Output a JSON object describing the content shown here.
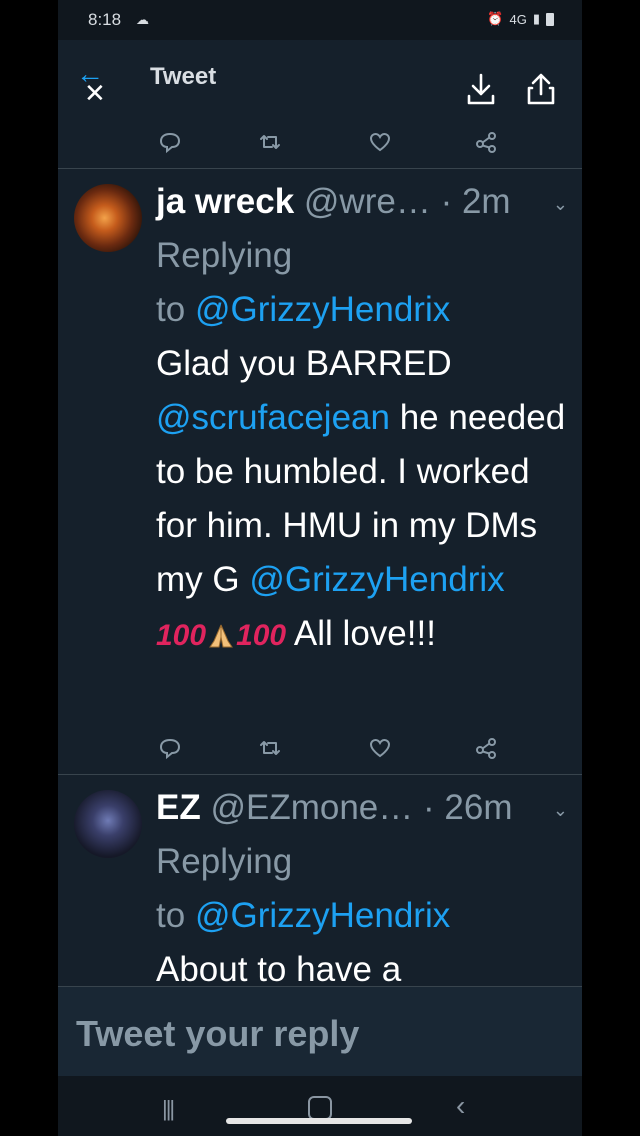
{
  "status_bar": {
    "time": "8:18",
    "network": "4G"
  },
  "header": {
    "title": "Tweet"
  },
  "icons": {
    "back": "arrow-left-icon",
    "close": "close-icon",
    "download": "download-icon",
    "share": "share-icon",
    "reply": "reply-icon",
    "retweet": "retweet-icon",
    "like": "heart-icon",
    "share_tweet": "share-nodes-icon"
  },
  "tweets": [
    {
      "name": "ja wreck",
      "handle": "@wre…",
      "time": "· 2m",
      "replying_prefix": "Replying",
      "replying_to_word": "to",
      "replying_to": "@GrizzyHendrix",
      "text_1": "Glad you BARRED",
      "mention_1": "@scrufacejean",
      "text_2": "he needed to be humbled. I worked for him. HMU in my DMs my G",
      "mention_2": "@GrizzyHendrix",
      "emoji_1": "100",
      "emoji_2": "100",
      "text_3": "All love!!!"
    },
    {
      "name": "EZ",
      "handle": "@EZmone…",
      "time": "· 26m",
      "replying_prefix": "Replying",
      "replying_to_word": "to",
      "replying_to": "@GrizzyHendrix",
      "text_1": "About to have a"
    }
  ],
  "reply_box": {
    "placeholder": "Tweet your reply"
  },
  "colors": {
    "background": "#15202b",
    "link": "#1da1f2",
    "muted": "#8899a6"
  }
}
